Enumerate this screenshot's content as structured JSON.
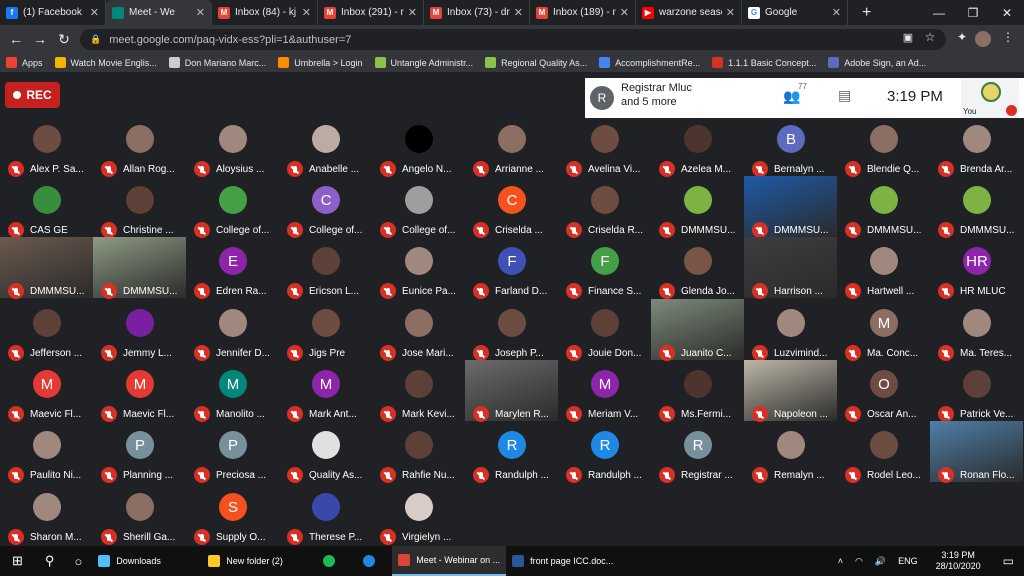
{
  "browser": {
    "tabs": [
      {
        "title": "(1) Facebook",
        "icon": "facebook-icon",
        "color": "#1877f2",
        "glyph": "f",
        "active": false
      },
      {
        "title": "Meet - We",
        "icon": "meet-icon",
        "color": "#00897b",
        "glyph": "",
        "active": true
      },
      {
        "title": "Inbox (84) - kj",
        "icon": "gmail-icon",
        "color": "#ea4335",
        "glyph": "M",
        "active": false
      },
      {
        "title": "Inbox (291) - r",
        "icon": "gmail-icon",
        "color": "#ea4335",
        "glyph": "M",
        "active": false
      },
      {
        "title": "Inbox (73) - dr",
        "icon": "gmail-icon",
        "color": "#ea4335",
        "glyph": "M",
        "active": false
      },
      {
        "title": "Inbox (189) - r",
        "icon": "gmail-icon",
        "color": "#ea4335",
        "glyph": "M",
        "active": false
      },
      {
        "title": "warzone seasc",
        "icon": "youtube-icon",
        "color": "#ff0000",
        "glyph": "▶",
        "active": false
      },
      {
        "title": "Google",
        "icon": "google-icon",
        "color": "#ffffff",
        "glyph": "G",
        "active": false
      }
    ],
    "new_tab": "+",
    "url": "meet.google.com/paq-vidx-ess?pli=1&authuser=7",
    "bookmarks": [
      {
        "label": "Apps",
        "color": "#ea4335"
      },
      {
        "label": "Watch Movie Englis...",
        "color": "#f4b400"
      },
      {
        "label": "Don Mariano Marc...",
        "color": "#cccccc"
      },
      {
        "label": "Umbrella > Login",
        "color": "#ff8a00"
      },
      {
        "label": "Untangle Administr...",
        "color": "#8bc34a"
      },
      {
        "label": "Regional Quality As...",
        "color": "#8bc34a"
      },
      {
        "label": "AccomplishmentRe...",
        "color": "#4285f4"
      },
      {
        "label": "1.1.1 Basic Concept...",
        "color": "#d93025"
      },
      {
        "label": "Adobe Sign, an Ad...",
        "color": "#5c6bc0"
      }
    ]
  },
  "meeting": {
    "rec_label": "REC",
    "presenter_initial": "R",
    "presenter_text": "Registrar Mluc",
    "presenter_more": "and 5 more",
    "people_count": "77",
    "time": "3:19 PM",
    "you_label": "You"
  },
  "participants": [
    {
      "name": "Alex P. Sa...",
      "type": "photo",
      "color": "#6d4c41"
    },
    {
      "name": "Allan Rog...",
      "type": "photo",
      "color": "#8d6e63"
    },
    {
      "name": "Aloysius ...",
      "type": "photo",
      "color": "#a1887f"
    },
    {
      "name": "Anabelle ...",
      "type": "photo",
      "color": "#bcaaa4"
    },
    {
      "name": "Angelo N...",
      "type": "photo",
      "color": "#000000"
    },
    {
      "name": "Arrianne ...",
      "type": "photo",
      "color": "#8d6e63"
    },
    {
      "name": "Avelina Vi...",
      "type": "photo",
      "color": "#6d4c41"
    },
    {
      "name": "Azelea M...",
      "type": "photo",
      "color": "#4e342e"
    },
    {
      "name": "Bernalyn ...",
      "type": "initial",
      "initial": "B",
      "color": "#5c6bc0"
    },
    {
      "name": "Blendie Q...",
      "type": "photo",
      "color": "#8d6e63"
    },
    {
      "name": "Brenda Ar...",
      "type": "photo",
      "color": "#a1887f"
    },
    {
      "name": "CAS GE",
      "type": "photo",
      "color": "#388e3c"
    },
    {
      "name": "Christine ...",
      "type": "photo",
      "color": "#5d4037"
    },
    {
      "name": "College of...",
      "type": "photo",
      "color": "#43a047"
    },
    {
      "name": "College of...",
      "type": "initial",
      "initial": "C",
      "color": "#8e5fc9"
    },
    {
      "name": "College of...",
      "type": "photo",
      "color": "#9e9e9e"
    },
    {
      "name": "Criselda ...",
      "type": "initial",
      "initial": "C",
      "color": "#f4511e"
    },
    {
      "name": "Criselda R...",
      "type": "photo",
      "color": "#6d4c41"
    },
    {
      "name": "DMMMSU...",
      "type": "photo",
      "color": "#7cb342"
    },
    {
      "name": "DMMMSU...",
      "type": "video",
      "color": "#1e5aa8"
    },
    {
      "name": "DMMMSU...",
      "type": "photo",
      "color": "#7cb342"
    },
    {
      "name": "DMMMSU...",
      "type": "photo",
      "color": "#7cb342"
    },
    {
      "name": "DMMMSU...",
      "type": "video",
      "color": "#6b5a4f"
    },
    {
      "name": "DMMMSU...",
      "type": "video",
      "color": "#8e9b84"
    },
    {
      "name": "Edren Ra...",
      "type": "initial",
      "initial": "E",
      "color": "#8e24aa"
    },
    {
      "name": "Ericson L...",
      "type": "photo",
      "color": "#5d4037"
    },
    {
      "name": "Eunice Pa...",
      "type": "photo",
      "color": "#a1887f"
    },
    {
      "name": "Farland D...",
      "type": "initial",
      "initial": "F",
      "color": "#3f51b5"
    },
    {
      "name": "Finance S...",
      "type": "initial",
      "initial": "F",
      "color": "#43a047"
    },
    {
      "name": "Glenda Jo...",
      "type": "photo",
      "color": "#795548"
    },
    {
      "name": "Harrison ...",
      "type": "video",
      "color": "#3e3e3e"
    },
    {
      "name": "Hartwell ...",
      "type": "photo",
      "color": "#a1887f"
    },
    {
      "name": "HR MLUC",
      "type": "initial",
      "initial": "HR",
      "color": "#8e24aa"
    },
    {
      "name": "Jefferson ...",
      "type": "photo",
      "color": "#5d4037"
    },
    {
      "name": "Jemmy L...",
      "type": "photo",
      "color": "#7b1fa2"
    },
    {
      "name": "Jennifer D...",
      "type": "photo",
      "color": "#a1887f"
    },
    {
      "name": "Jigs Pre",
      "type": "photo",
      "color": "#6d4c41"
    },
    {
      "name": "Jose Mari...",
      "type": "photo",
      "color": "#8d6e63"
    },
    {
      "name": "Joseph P...",
      "type": "photo",
      "color": "#6d4c41"
    },
    {
      "name": "Jouie Don...",
      "type": "photo",
      "color": "#5d4037"
    },
    {
      "name": "Juanito C...",
      "type": "video",
      "color": "#7d8b7a"
    },
    {
      "name": "Luzvimind...",
      "type": "photo",
      "color": "#a1887f"
    },
    {
      "name": "Ma. Conc...",
      "type": "initial",
      "initial": "M",
      "color": "#8d6e63"
    },
    {
      "name": "Ma. Teres...",
      "type": "photo",
      "color": "#a1887f"
    },
    {
      "name": "Maevic Fl...",
      "type": "initial",
      "initial": "M",
      "color": "#e53935"
    },
    {
      "name": "Maevic Fl...",
      "type": "initial",
      "initial": "M",
      "color": "#e53935"
    },
    {
      "name": "Manolito ...",
      "type": "initial",
      "initial": "M",
      "color": "#00897b"
    },
    {
      "name": "Mark Ant...",
      "type": "initial",
      "initial": "M",
      "color": "#8e24aa"
    },
    {
      "name": "Mark Kevi...",
      "type": "photo",
      "color": "#5d4037"
    },
    {
      "name": "Marylen R...",
      "type": "video",
      "color": "#6b6b6b"
    },
    {
      "name": "Meriam V...",
      "type": "initial",
      "initial": "M",
      "color": "#8e24aa"
    },
    {
      "name": "Ms.Fermi...",
      "type": "photo",
      "color": "#4e342e"
    },
    {
      "name": "Napoleon ...",
      "type": "video",
      "color": "#bdb7a8"
    },
    {
      "name": "Oscar An...",
      "type": "initial",
      "initial": "O",
      "color": "#6d4c41"
    },
    {
      "name": "Patrick Ve...",
      "type": "photo",
      "color": "#5d4037"
    },
    {
      "name": "Paulito Ni...",
      "type": "photo",
      "color": "#a1887f"
    },
    {
      "name": "Planning ...",
      "type": "initial",
      "initial": "P",
      "color": "#78909c"
    },
    {
      "name": "Preciosa ...",
      "type": "initial",
      "initial": "P",
      "color": "#78909c"
    },
    {
      "name": "Quality As...",
      "type": "photo",
      "color": "#e0e0e0"
    },
    {
      "name": "Rahfie Nu...",
      "type": "photo",
      "color": "#5d4037"
    },
    {
      "name": "Randulph ...",
      "type": "initial",
      "initial": "R",
      "color": "#1e88e5"
    },
    {
      "name": "Randulph ...",
      "type": "initial",
      "initial": "R",
      "color": "#1e88e5"
    },
    {
      "name": "Registrar ...",
      "type": "initial",
      "initial": "R",
      "color": "#78909c"
    },
    {
      "name": "Remalyn ...",
      "type": "photo",
      "color": "#a1887f"
    },
    {
      "name": "Rodel Leo...",
      "type": "photo",
      "color": "#6d4c41"
    },
    {
      "name": "Ronan Flo...",
      "type": "video",
      "color": "#4f7fa8"
    },
    {
      "name": "Sharon M...",
      "type": "photo",
      "color": "#a1887f"
    },
    {
      "name": "Sherill Ga...",
      "type": "photo",
      "color": "#8d6e63"
    },
    {
      "name": "Supply O...",
      "type": "initial",
      "initial": "S",
      "color": "#f4511e"
    },
    {
      "name": "Therese P...",
      "type": "photo",
      "color": "#3949ab"
    },
    {
      "name": "Virgielyn ...",
      "type": "photo",
      "color": "#d7ccc8"
    }
  ],
  "taskbar": {
    "items": [
      {
        "label": "Downloads",
        "icon": "folder-download-icon",
        "color": "#4fc3f7",
        "active": false
      },
      {
        "label": "New folder (2)",
        "icon": "folder-icon",
        "color": "#ffca28",
        "active": false
      },
      {
        "label": "",
        "icon": "spotify-icon",
        "color": "#1db954",
        "active": false
      },
      {
        "label": "",
        "icon": "edge-icon",
        "color": "#1e88e5",
        "active": false
      },
      {
        "label": "Meet - Webinar on ...",
        "icon": "chrome-icon",
        "color": "#db4437",
        "active": true
      },
      {
        "label": "front page ICC.doc...",
        "icon": "word-icon",
        "color": "#2b579a",
        "active": false
      }
    ],
    "language": "ENG",
    "time": "3:19 PM",
    "date": "28/10/2020"
  }
}
